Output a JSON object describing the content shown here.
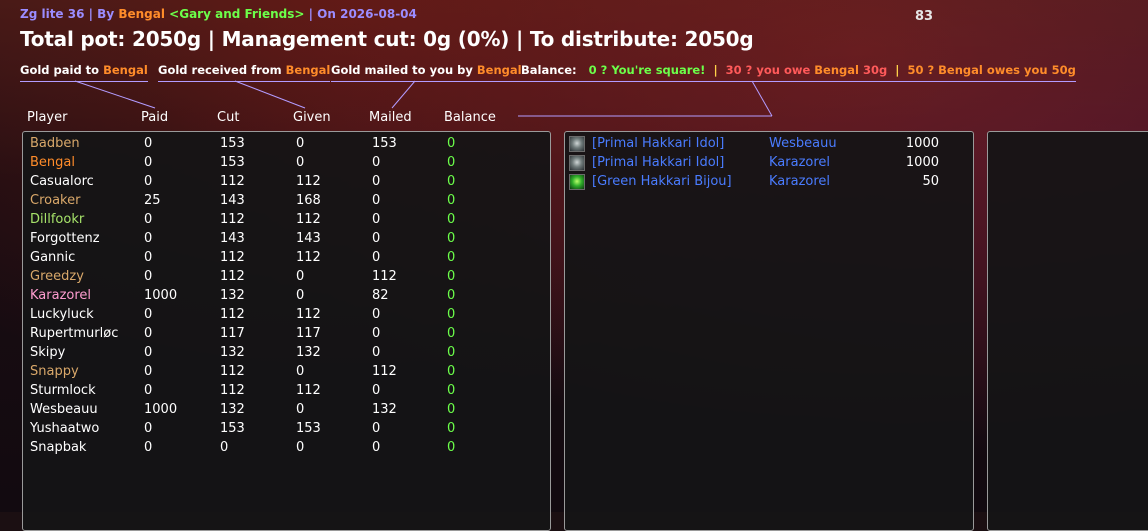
{
  "header": {
    "prefix": "Zg lite 36 | By ",
    "author": "Bengal",
    "guild": "<Gary and Friends>",
    "sep": " | On ",
    "date": "2026-08-04",
    "level": "83"
  },
  "summary": {
    "title": "Total pot: 2050g | Management cut: 0g (0%) | To distribute: 2050g"
  },
  "legend": {
    "paid_label": "Gold paid to ",
    "paid_name": "Bengal",
    "received_label": "Gold received from ",
    "received_name": "Bengal",
    "mailed_label": "Gold mailed to you by ",
    "mailed_name": "Bengal",
    "balance_label": "Balance:",
    "square_text": "0 ? You're square!",
    "pipe": "|",
    "owe_prefix": "30 ? you owe ",
    "owe_name": "Bengal",
    "owe_amount": " 30g",
    "owes_text": "50 ? Bengal owes you 50g"
  },
  "columns": {
    "player": "Player",
    "paid": "Paid",
    "cut": "Cut",
    "given": "Given",
    "mailed": "Mailed",
    "balance": "Balance"
  },
  "colors": {
    "orange": "#ff8c2a",
    "green": "#6cff4a",
    "red": "#ff5a5a",
    "white": "#ffffff",
    "purple": "#9b8cff",
    "rogue": "#ff9dd0",
    "tan": "#d9a86a",
    "olive": "#a6e36a",
    "link_blue": "#4a7cff"
  },
  "players": [
    {
      "name": "Badben",
      "color": "#d9a86a",
      "paid": "0",
      "cut": "153",
      "given": "0",
      "mailed": "153",
      "balance": "0"
    },
    {
      "name": "Bengal",
      "color": "#ff8c2a",
      "paid": "0",
      "cut": "153",
      "given": "0",
      "mailed": "0",
      "balance": "0"
    },
    {
      "name": "Casualorc",
      "color": "#ffffff",
      "paid": "0",
      "cut": "112",
      "given": "112",
      "mailed": "0",
      "balance": "0"
    },
    {
      "name": "Croaker",
      "color": "#d9a86a",
      "paid": "25",
      "cut": "143",
      "given": "168",
      "mailed": "0",
      "balance": "0"
    },
    {
      "name": "Dillfookr",
      "color": "#a6e36a",
      "paid": "0",
      "cut": "112",
      "given": "112",
      "mailed": "0",
      "balance": "0"
    },
    {
      "name": "Forgottenz",
      "color": "#ffffff",
      "paid": "0",
      "cut": "143",
      "given": "143",
      "mailed": "0",
      "balance": "0"
    },
    {
      "name": "Gannic",
      "color": "#ffffff",
      "paid": "0",
      "cut": "112",
      "given": "112",
      "mailed": "0",
      "balance": "0"
    },
    {
      "name": "Greedzy",
      "color": "#d9a86a",
      "paid": "0",
      "cut": "112",
      "given": "0",
      "mailed": "112",
      "balance": "0"
    },
    {
      "name": "Karazorel",
      "color": "#ff9dd0",
      "paid": "1000",
      "cut": "132",
      "given": "0",
      "mailed": "82",
      "balance": "0"
    },
    {
      "name": "Luckyluck",
      "color": "#ffffff",
      "paid": "0",
      "cut": "112",
      "given": "112",
      "mailed": "0",
      "balance": "0"
    },
    {
      "name": "Rupertmurløc",
      "color": "#ffffff",
      "paid": "0",
      "cut": "117",
      "given": "117",
      "mailed": "0",
      "balance": "0"
    },
    {
      "name": "Skipy",
      "color": "#ffffff",
      "paid": "0",
      "cut": "132",
      "given": "132",
      "mailed": "0",
      "balance": "0"
    },
    {
      "name": "Snappy",
      "color": "#d9a86a",
      "paid": "0",
      "cut": "112",
      "given": "0",
      "mailed": "112",
      "balance": "0"
    },
    {
      "name": "Sturmlock",
      "color": "#ffffff",
      "paid": "0",
      "cut": "112",
      "given": "112",
      "mailed": "0",
      "balance": "0"
    },
    {
      "name": "Wesbeauu",
      "color": "#ffffff",
      "paid": "1000",
      "cut": "132",
      "given": "0",
      "mailed": "132",
      "balance": "0"
    },
    {
      "name": "Yushaatwo",
      "color": "#ffffff",
      "paid": "0",
      "cut": "153",
      "given": "153",
      "mailed": "0",
      "balance": "0"
    },
    {
      "name": "Snapbak",
      "color": "#ffffff",
      "paid": "0",
      "cut": "0",
      "given": "0",
      "mailed": "0",
      "balance": "0"
    }
  ],
  "loot": [
    {
      "item": "[Primal Hakkari Idol]",
      "icon": "idol-icon",
      "winner": "Wesbeauu",
      "amount": "1000"
    },
    {
      "item": "[Primal Hakkari Idol]",
      "icon": "idol-icon",
      "winner": "Karazorel",
      "amount": "1000"
    },
    {
      "item": "[Green Hakkari Bijou]",
      "icon": "bijou-icon",
      "winner": "Karazorel",
      "amount": "50"
    }
  ]
}
